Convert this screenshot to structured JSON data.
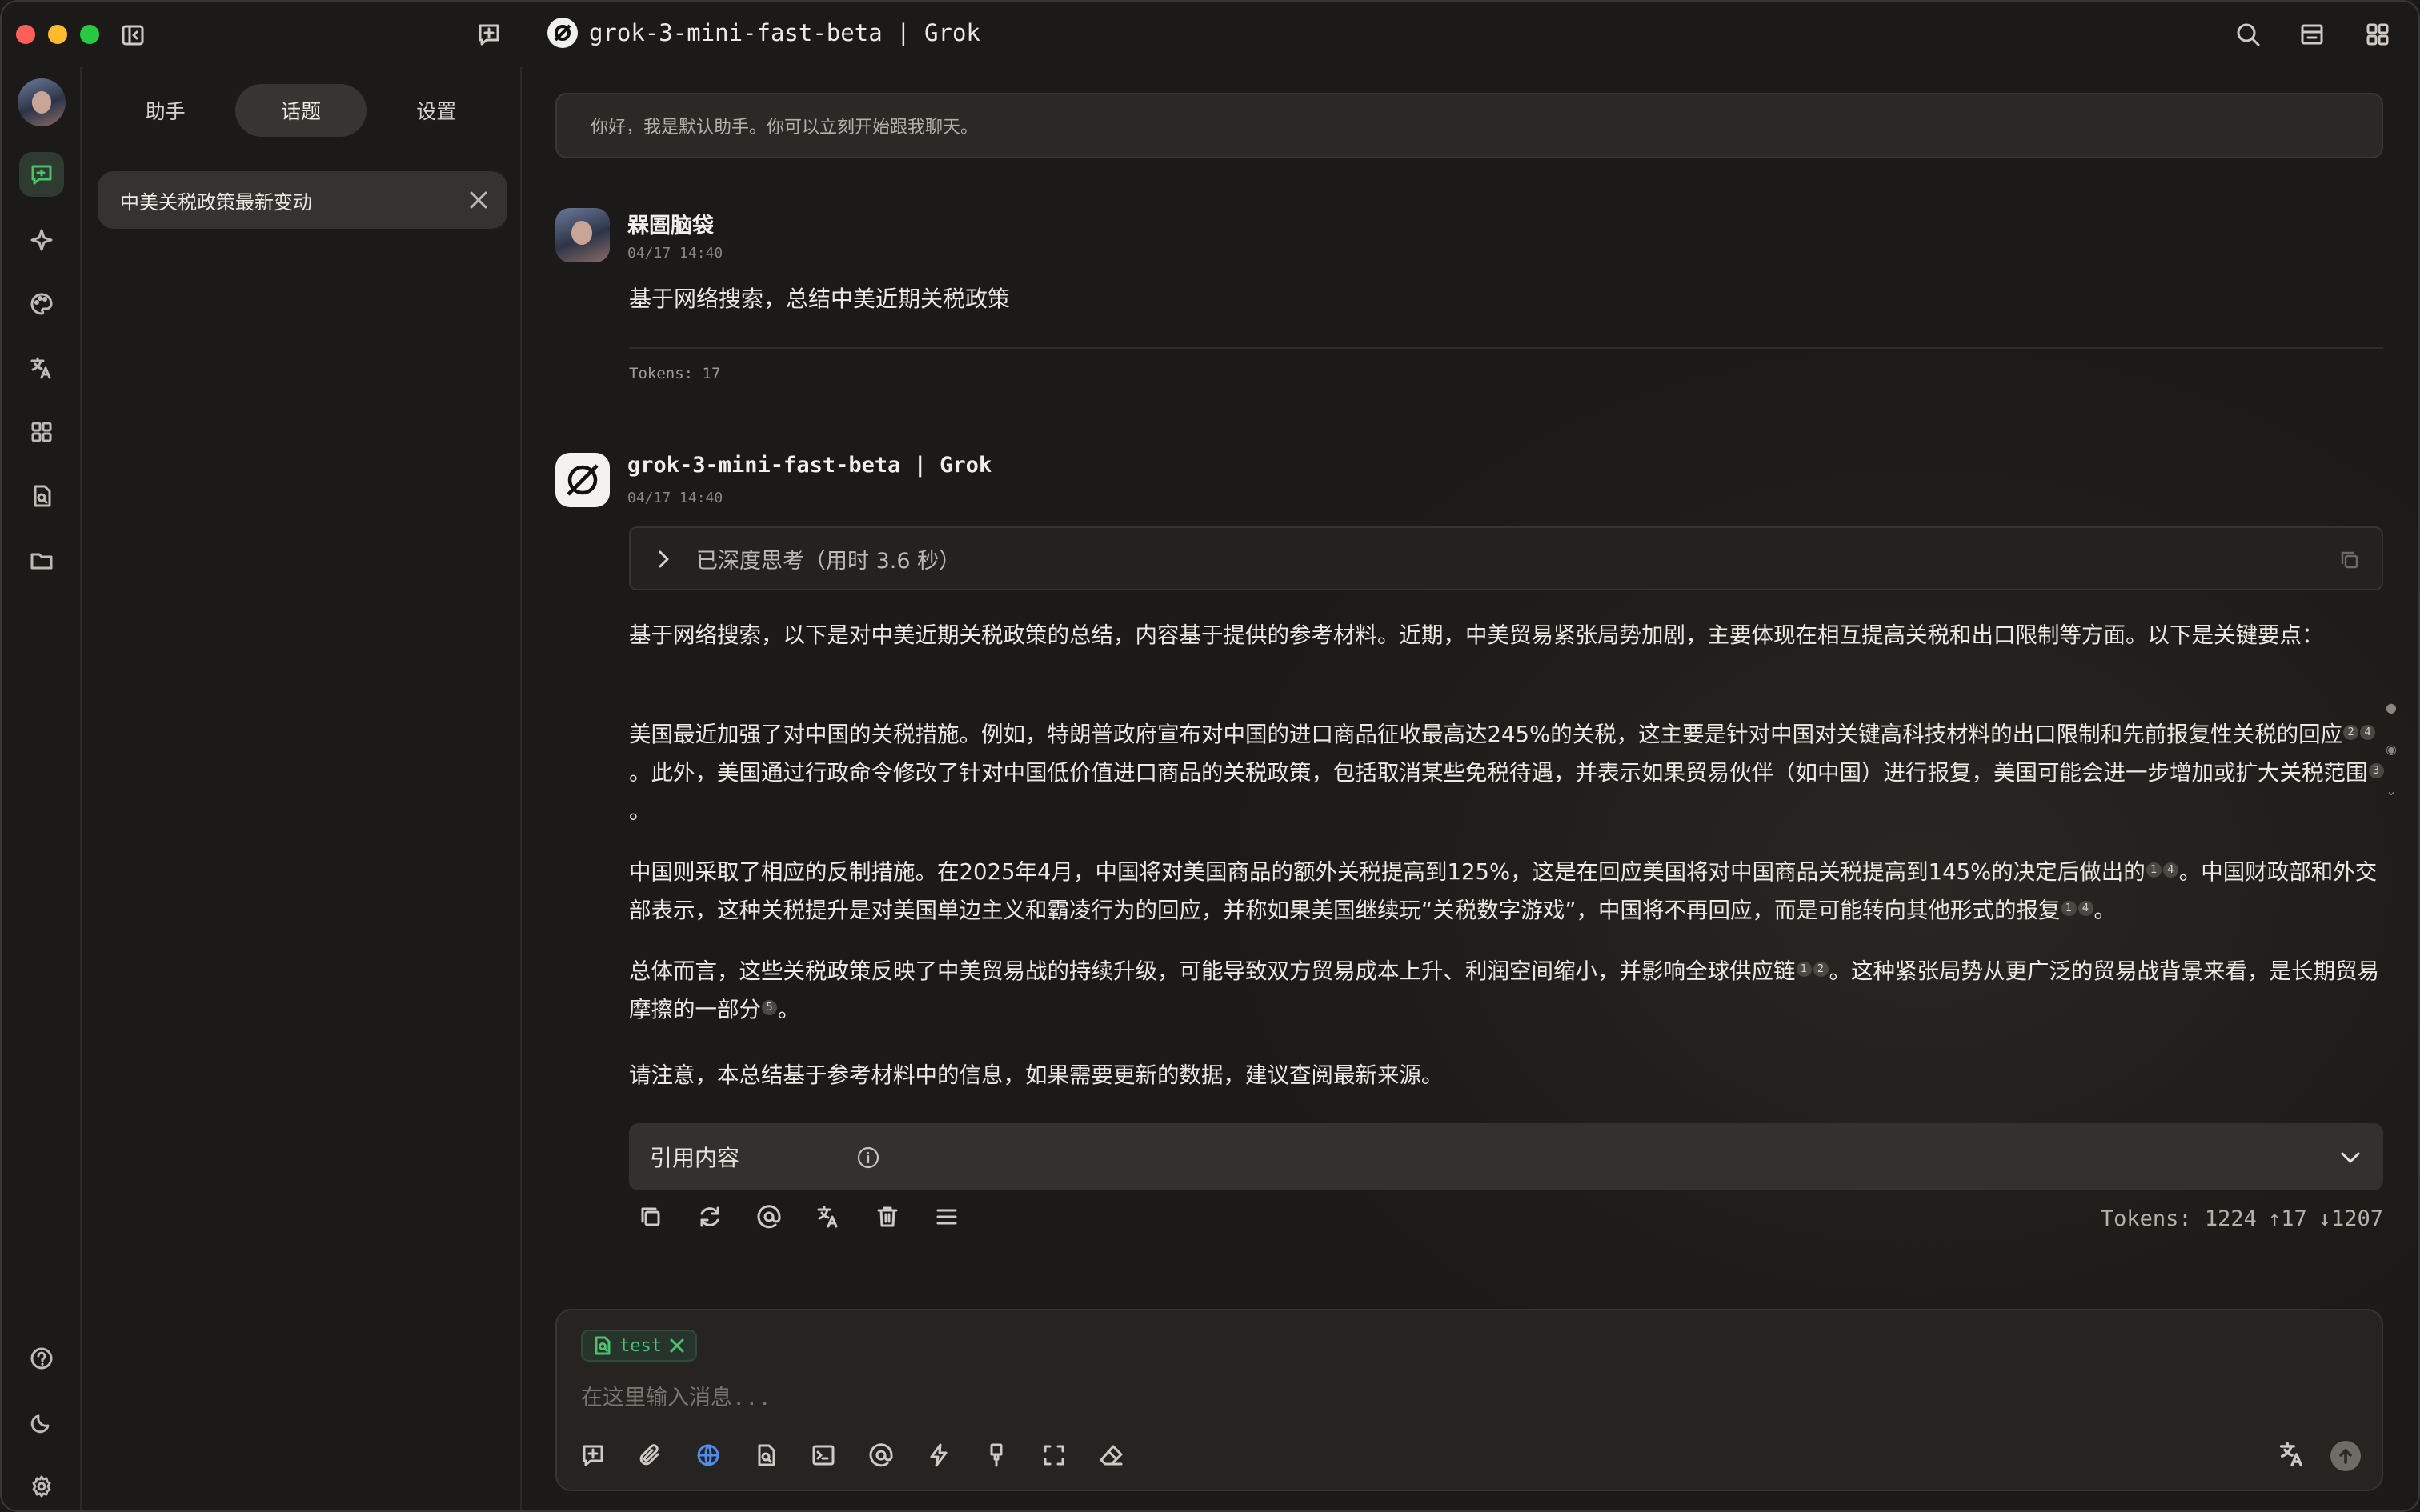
{
  "window": {
    "title": "grok-3-mini-fast-beta | Grok"
  },
  "sidebar": {
    "tabs": [
      {
        "label": "助手"
      },
      {
        "label": "话题",
        "active": true
      },
      {
        "label": "设置"
      }
    ],
    "topic": {
      "label": "中美关税政策最新变动"
    }
  },
  "chat": {
    "welcome": "你好，我是默认助手。你可以立刻开始跟我聊天。",
    "user_message": {
      "name": "槑圄脑袋",
      "time": "04/17 14:40",
      "text": "基于网络搜索，总结中美近期关税政策",
      "tokens": "Tokens: 17"
    },
    "bot_message": {
      "name": "grok-3-mini-fast-beta | Grok",
      "time": "04/17 14:40",
      "thinking_label": "已深度思考（用时 3.6 秒）",
      "p1": "基于网络搜索，以下是对中美近期关税政策的总结，内容基于提供的参考材料。近期，中美贸易紧张局势加剧，主要体现在相互提高关税和出口限制等方面。以下是关键要点：",
      "p2_a": "美国最近加强了对中国的关税措施。例如，特朗普政府宣布对中国的进口商品征收最高达245%的关税，这主要是针对中国对关键高科技材料的出口限制和先前报复性关税的回应",
      "p2_b": "。此外，美国通过行政命令修改了针对中国低价值进口商品的关税政策，包括取消某些免税待遇，并表示如果贸易伙伴（如中国）进行报复，美国可能会进一步增加或扩大关税范围",
      "p2_c": "。",
      "p3_a": "中国则采取了相应的反制措施。在2025年4月，中国将对美国商品的额外关税提高到125%，这是在回应美国将对中国商品关税提高到145%的决定后做出的",
      "p3_b": "。中国财政部和外交部表示，这种关税提升是对美国单边主义和霸凌行为的回应，并称如果美国继续玩“关税数字游戏”，中国将不再回应，而是可能转向其他形式的报复",
      "p3_c": "。",
      "p4_a": "总体而言，这些关税政策反映了中美贸易战的持续升级，可能导致双方贸易成本上升、利润空间缩小，并影响全球供应链",
      "p4_b": "。这种紧张局势从更广泛的贸易战背景来看，是长期贸易摩擦的一部分",
      "p4_c": "。",
      "p5": "请注意，本总结基于参考材料中的信息，如果需要更新的数据，建议查阅最新来源。",
      "cites": {
        "c1": "2",
        "c2": "4",
        "c3": "3",
        "c4": "1",
        "c5": "4",
        "c6": "1",
        "c7": "4",
        "c8": "1",
        "c9": "2",
        "c10": "5"
      },
      "references_label": "引用内容",
      "tokens_total": "Tokens: 1224",
      "tokens_up": "↑17",
      "tokens_down": "↓1207"
    }
  },
  "composer": {
    "knowledge_tag": "test",
    "placeholder": "在这里输入消息..."
  },
  "colors": {
    "accent_green": "#46c46a",
    "web_search_blue": "#4b8df0"
  }
}
